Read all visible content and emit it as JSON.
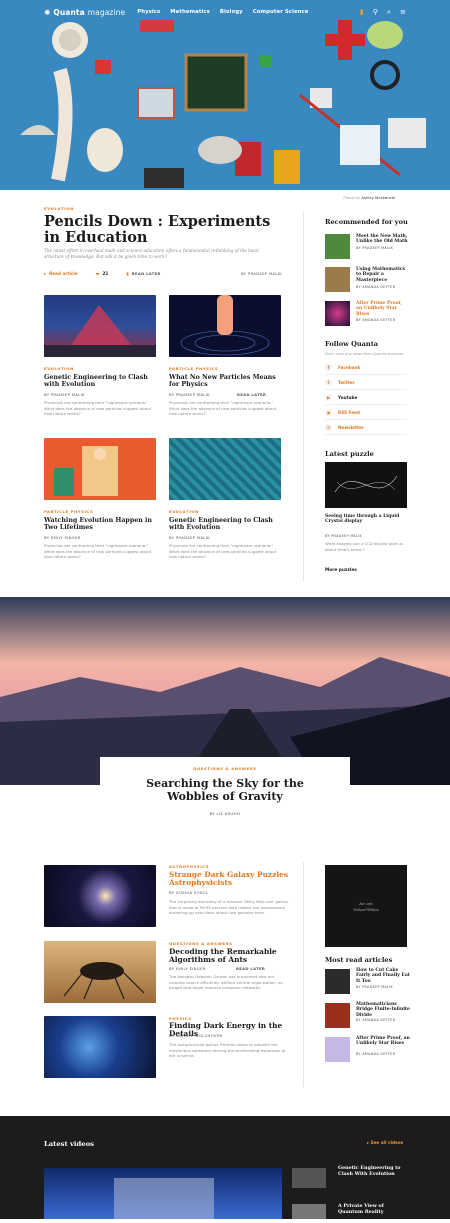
{
  "header": {
    "logo_a": "Quanta",
    "logo_b": "magazine",
    "nav": [
      "Physics",
      "Mathematics",
      "Biology",
      "Computer Science"
    ],
    "photo_credit_label": "Photo by",
    "photo_credit_name": "Ashley Mackenzie"
  },
  "article": {
    "category": "Evolution",
    "title": "Pencils Down : Experiments in Education",
    "lead": "The latest effort to overhaul math and science education offers a fundamental rethinking of the basic structure of knowledge. But will it be given time to work?",
    "read": "Read article",
    "comments": "21",
    "read_later": "Read later",
    "author": "By Pradeep Malik"
  },
  "cards": [
    {
      "cat": "Evolution",
      "title": "Genetic Engineering to Clash with Evolution",
      "meta": "By Pradeep Malik",
      "excerpt": "Physicists are confronting their \"nightmare scenario.\" What does the absence of new particles suggest about how nature works?"
    },
    {
      "cat": "Particle Physics",
      "title": "What No New Particles Means for Physics",
      "meta": "By Pradeep Malik",
      "later": "Read later",
      "excerpt": "Physicists are confronting their \"nightmare scenario.\" What does the absence of new particles suggest about how nature works?"
    },
    {
      "cat": "Particle Physics",
      "title": "Watching Evolution Happen in Two Lifetimes",
      "meta": "By Emily Singer",
      "excerpt": "Physicists are confronting their \"nightmare scenario.\" What does the absence of new particles suggest about how nature works?"
    },
    {
      "cat": "Evolution",
      "title": "Genetic Engineering to Clash with Evolution",
      "meta": "By Pradeep Malik",
      "excerpt": "Physicists are confronting their \"nightmare scenario.\" What does the absence of new particles suggest about how nature works?"
    }
  ],
  "sidebar": {
    "rec_head": "Recommended for you",
    "recs": [
      {
        "title": "Meet the New Math, Unlike the Old Math",
        "by": "By Pradeep Malik"
      },
      {
        "title": "Using Mathematics to Repair a Masterpiece",
        "by": "By Amanda Gefter"
      },
      {
        "title": "After Prime Proof, an Unlikely Star Rises",
        "by": "By Amanda Gefter"
      }
    ],
    "follow_head": "Follow Quanta",
    "follow_sub": "Don't miss any news from Quanta anymore",
    "follow": [
      "Facebook",
      "Twitter",
      "Youtube",
      "RSS Feed",
      "Newsletter"
    ],
    "puzzle_head": "Latest puzzle",
    "puzzle_title": "Seeing time through a Liquid Crystal display",
    "puzzle_by": "By Pradeep Malik",
    "puzzle_text": "What insights can a LCD display give us about time's arrow ?",
    "more_puzzles": "More puzzles"
  },
  "feature": {
    "cat": "Questions & Answers",
    "title": "Searching the Sky for the Wobbles of Gravity",
    "by": "By Liz Kruesi"
  },
  "list": [
    {
      "cat": "Astrophysics",
      "title": "Strange Dark Galaxy Puzzles Astrophysicists",
      "by": "By Joshua Sokol",
      "text": "The surprising discovery of a massive 'Milky Way-size' galaxy that is made of 99.99 percent dark matter has astronomers dreaming up new ideas about how galaxies form."
    },
    {
      "cat": "Questions & Answers",
      "title": "Decoding the Remarkable Algorithms of Ants",
      "by": "By Emily Singer",
      "later": "Read later",
      "text": "The biologist Deborah Gordon has uncovered how ant colonies search efficiently without central organization, an insight that might improve computer networks."
    },
    {
      "cat": "Physics",
      "title": "Finding Dark Energy in the Details",
      "by": "By Natalie Wolchover",
      "text": "The astrophysicist Joshua Frieman seeks to pinpoint the mysterious substance driving the accelerating expansion of the universe."
    }
  ],
  "ad": {
    "line1": "Ad unit",
    "line2": "300px*580px"
  },
  "most_read": {
    "head": "Most read articles",
    "items": [
      {
        "title": "How to Cut Cake Fairly and Finally Eat It Too",
        "by": "By Pradeep Malik"
      },
      {
        "title": "Mathematicians Bridge Finite-Infinite Divide",
        "by": "By Amanda Gefter"
      },
      {
        "title": "After Prime Proof, an Unlikely Star Rises",
        "by": "By Amanda Gefter"
      }
    ]
  },
  "videos": {
    "head": "Latest videos",
    "see_all": "See all videos",
    "items": [
      {
        "title": "Genetic Engineering to Clash With Evolution"
      },
      {
        "title": "A Private View of Quantum Reality"
      }
    ]
  }
}
